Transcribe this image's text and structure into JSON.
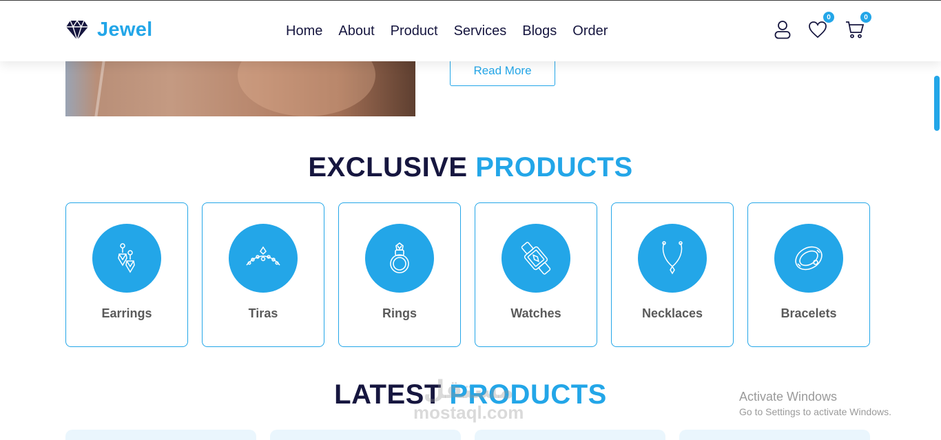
{
  "brand": {
    "name": "Jewel",
    "logo_icon": "diamond-icon",
    "color": "#23a6e8"
  },
  "nav": [
    {
      "label": "Home"
    },
    {
      "label": "About"
    },
    {
      "label": "Product"
    },
    {
      "label": "Services"
    },
    {
      "label": "Blogs"
    },
    {
      "label": "Order"
    }
  ],
  "header_icons": {
    "user_icon": "user-icon",
    "wishlist_icon": "heart-icon",
    "wishlist_count": "0",
    "cart_icon": "cart-icon",
    "cart_count": "0"
  },
  "hero": {
    "read_more": "Read More"
  },
  "exclusive": {
    "title_dark": "EXCLUSIVE",
    "title_blue": "PRODUCTS",
    "categories": [
      {
        "label": "Earrings",
        "icon": "earring-icon"
      },
      {
        "label": "Tiras",
        "icon": "tiara-icon"
      },
      {
        "label": "Rings",
        "icon": "ring-icon"
      },
      {
        "label": "Watches",
        "icon": "watch-icon"
      },
      {
        "label": "Necklaces",
        "icon": "necklace-icon"
      },
      {
        "label": "Bracelets",
        "icon": "bracelet-icon"
      }
    ]
  },
  "latest": {
    "title_dark": "LATEST",
    "title_blue": "PRODUCTS"
  },
  "watermark": {
    "arabic": "مستقل",
    "latin": "mostaql.com"
  },
  "windows": {
    "title": "Activate Windows",
    "subtitle": "Go to Settings to activate Windows."
  },
  "colors": {
    "accent": "#23a6e8",
    "dark": "#16163f",
    "label": "#5a5a5a"
  }
}
